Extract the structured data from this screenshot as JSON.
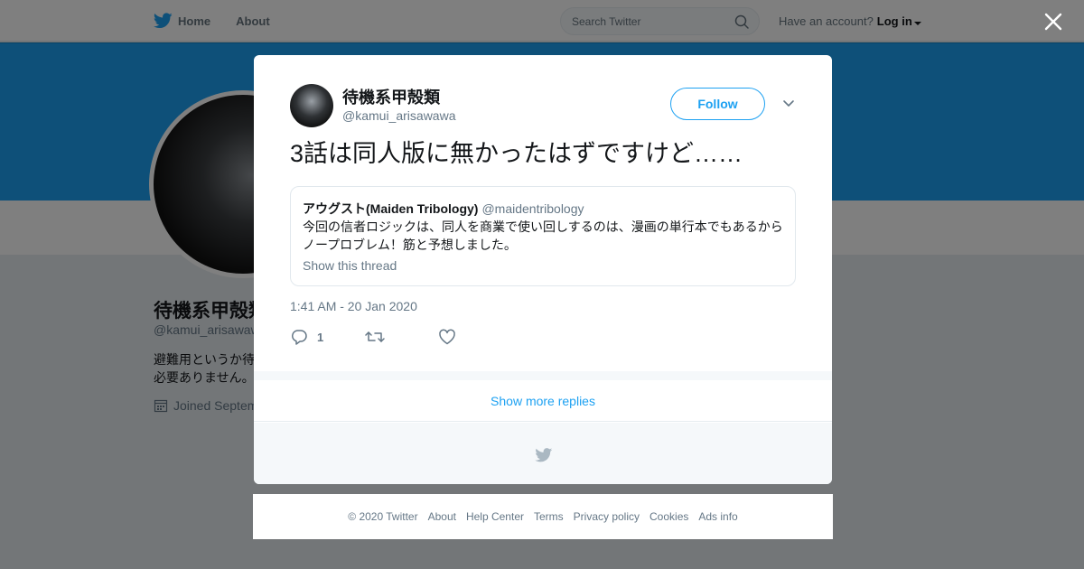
{
  "nav": {
    "home_label": "Home",
    "about_label": "About",
    "search_placeholder": "Search Twitter",
    "account_prompt": "Have an account?",
    "login_label": "Log in"
  },
  "profile": {
    "name": "待機系甲殻類",
    "handle": "@kamui_arisawawa",
    "bio_line1": "避難用というか待",
    "bio_line2": "必要ありません。",
    "joined": "Joined Septem"
  },
  "tweet": {
    "fullname": "待機系甲殻類",
    "username": "@kamui_arisawawa",
    "follow_label": "Follow",
    "text": "3話は同人版に無かったはずですけど……",
    "timestamp": "1:41 AM - 20 Jan 2020",
    "reply_count": "1",
    "quote": {
      "name": "アウグスト(Maiden Tribology)",
      "handle": "@maidentribology",
      "text": "今回の信者ロジックは、同人を商業で使い回しするのは、漫画の単行本でもあるからノープロブレム！筋と予想しました。",
      "link": "Show this thread"
    }
  },
  "modal": {
    "show_more_label": "Show more replies"
  },
  "footer": {
    "copyright": "© 2020 Twitter",
    "links": [
      "About",
      "Help Center",
      "Terms",
      "Privacy policy",
      "Cookies",
      "Ads info"
    ]
  },
  "colors": {
    "accent": "#1da1f2",
    "banner": "#1da1f2",
    "text_primary": "#14171a",
    "text_secondary": "#657786"
  }
}
